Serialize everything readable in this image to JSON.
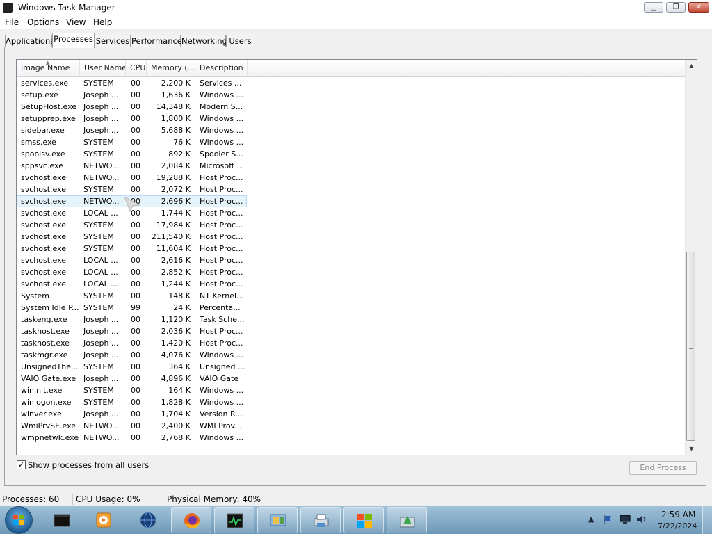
{
  "window": {
    "title": "Windows Task Manager"
  },
  "menu": [
    "File",
    "Options",
    "View",
    "Help"
  ],
  "tabs": [
    "Applications",
    "Processes",
    "Services",
    "Performance",
    "Networking",
    "Users"
  ],
  "active_tab": "Processes",
  "columns": [
    "Image Name",
    "User Name",
    "CPU",
    "Memory (...",
    "Description"
  ],
  "processes": [
    {
      "name": "services.exe",
      "user": "SYSTEM",
      "cpu": "00",
      "mem": "2,200 K",
      "desc": "Services ..."
    },
    {
      "name": "setup.exe",
      "user": "Joseph ...",
      "cpu": "00",
      "mem": "1,636 K",
      "desc": "Windows ..."
    },
    {
      "name": "SetupHost.exe",
      "user": "Joseph ...",
      "cpu": "00",
      "mem": "14,348 K",
      "desc": "Modern S..."
    },
    {
      "name": "setupprep.exe",
      "user": "Joseph ...",
      "cpu": "00",
      "mem": "1,800 K",
      "desc": "Windows ..."
    },
    {
      "name": "sidebar.exe",
      "user": "Joseph ...",
      "cpu": "00",
      "mem": "5,688 K",
      "desc": "Windows ..."
    },
    {
      "name": "smss.exe",
      "user": "SYSTEM",
      "cpu": "00",
      "mem": "76 K",
      "desc": "Windows ..."
    },
    {
      "name": "spoolsv.exe",
      "user": "SYSTEM",
      "cpu": "00",
      "mem": "892 K",
      "desc": "Spooler S..."
    },
    {
      "name": "sppsvc.exe",
      "user": "NETWO...",
      "cpu": "00",
      "mem": "2,084 K",
      "desc": "Microsoft ..."
    },
    {
      "name": "svchost.exe",
      "user": "NETWO...",
      "cpu": "00",
      "mem": "19,288 K",
      "desc": "Host Proc..."
    },
    {
      "name": "svchost.exe",
      "user": "SYSTEM",
      "cpu": "00",
      "mem": "2,072 K",
      "desc": "Host Proc..."
    },
    {
      "name": "svchost.exe",
      "user": "NETWO...",
      "cpu": "00",
      "mem": "2,696 K",
      "desc": "Host Proc...",
      "selected": true
    },
    {
      "name": "svchost.exe",
      "user": "LOCAL ...",
      "cpu": "00",
      "mem": "1,744 K",
      "desc": "Host Proc..."
    },
    {
      "name": "svchost.exe",
      "user": "SYSTEM",
      "cpu": "00",
      "mem": "17,984 K",
      "desc": "Host Proc..."
    },
    {
      "name": "svchost.exe",
      "user": "SYSTEM",
      "cpu": "00",
      "mem": "211,540 K",
      "desc": "Host Proc..."
    },
    {
      "name": "svchost.exe",
      "user": "SYSTEM",
      "cpu": "00",
      "mem": "11,604 K",
      "desc": "Host Proc..."
    },
    {
      "name": "svchost.exe",
      "user": "LOCAL ...",
      "cpu": "00",
      "mem": "2,616 K",
      "desc": "Host Proc..."
    },
    {
      "name": "svchost.exe",
      "user": "LOCAL ...",
      "cpu": "00",
      "mem": "2,852 K",
      "desc": "Host Proc..."
    },
    {
      "name": "svchost.exe",
      "user": "LOCAL ...",
      "cpu": "00",
      "mem": "1,244 K",
      "desc": "Host Proc..."
    },
    {
      "name": "System",
      "user": "SYSTEM",
      "cpu": "00",
      "mem": "148 K",
      "desc": "NT Kernel..."
    },
    {
      "name": "System Idle P...",
      "user": "SYSTEM",
      "cpu": "99",
      "mem": "24 K",
      "desc": "Percenta..."
    },
    {
      "name": "taskeng.exe",
      "user": "Joseph ...",
      "cpu": "00",
      "mem": "1,120 K",
      "desc": "Task Sche..."
    },
    {
      "name": "taskhost.exe",
      "user": "Joseph ...",
      "cpu": "00",
      "mem": "2,036 K",
      "desc": "Host Proc..."
    },
    {
      "name": "taskhost.exe",
      "user": "Joseph ...",
      "cpu": "00",
      "mem": "1,420 K",
      "desc": "Host Proc..."
    },
    {
      "name": "taskmgr.exe",
      "user": "Joseph ...",
      "cpu": "00",
      "mem": "4,076 K",
      "desc": "Windows ..."
    },
    {
      "name": "UnsignedThe...",
      "user": "SYSTEM",
      "cpu": "00",
      "mem": "364 K",
      "desc": "Unsigned ..."
    },
    {
      "name": "VAIO Gate.exe",
      "user": "Joseph ...",
      "cpu": "00",
      "mem": "4,896 K",
      "desc": "VAIO Gate"
    },
    {
      "name": "wininit.exe",
      "user": "SYSTEM",
      "cpu": "00",
      "mem": "164 K",
      "desc": "Windows ..."
    },
    {
      "name": "winlogon.exe",
      "user": "SYSTEM",
      "cpu": "00",
      "mem": "1,828 K",
      "desc": "Windows ..."
    },
    {
      "name": "winver.exe",
      "user": "Joseph ...",
      "cpu": "00",
      "mem": "1,704 K",
      "desc": "Version R..."
    },
    {
      "name": "WmiPrvSE.exe",
      "user": "NETWO...",
      "cpu": "00",
      "mem": "2,400 K",
      "desc": "WMI Prov..."
    },
    {
      "name": "wmpnetwk.exe",
      "user": "NETWO...",
      "cpu": "00",
      "mem": "2,768 K",
      "desc": "Windows ..."
    }
  ],
  "show_all_users": {
    "label": "Show processes from all users",
    "checked": true
  },
  "end_process_label": "End Process",
  "status": {
    "processes": "Processes: 60",
    "cpu": "CPU Usage: 0%",
    "memory": "Physical Memory: 40%"
  },
  "taskbar": {
    "items": [
      "command-prompt-icon",
      "media-player-icon",
      "globe-icon",
      "firefox-icon",
      "task-manager-icon",
      "control-panel-icon",
      "printer-icon",
      "windows-logo-icon",
      "image-editor-icon"
    ],
    "clock_time": "2:59 AM",
    "clock_date": "7/22/2024"
  },
  "colors": {
    "selected_row": "#e5f3fb",
    "taskbar": "#7ea7c4",
    "close_button": "#c34a36"
  }
}
